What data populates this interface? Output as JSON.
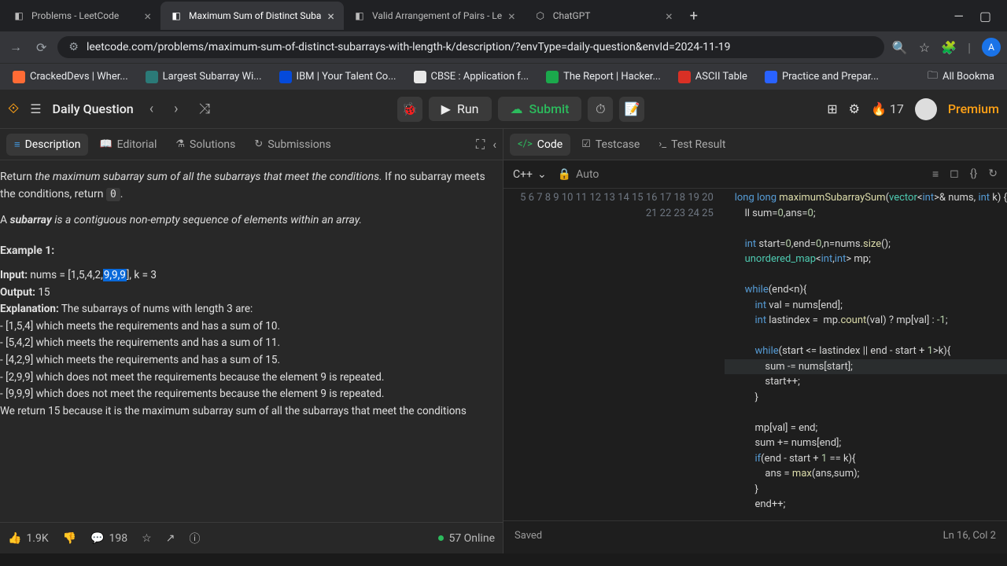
{
  "browser": {
    "tabs": [
      {
        "title": "Problems - LeetCode",
        "active": false
      },
      {
        "title": "Maximum Sum of Distinct Suba",
        "active": true
      },
      {
        "title": "Valid Arrangement of Pairs - Le",
        "active": false
      },
      {
        "title": "ChatGPT",
        "active": false
      }
    ],
    "url": "leetcode.com/problems/maximum-sum-of-distinct-subarrays-with-length-k/description/?envType=daily-question&envId=2024-11-19"
  },
  "bookmarks": [
    {
      "label": "CrackedDevs | Wher...",
      "color": "#ff6b35"
    },
    {
      "label": "Largest Subarray Wi...",
      "color": "#2b7a78"
    },
    {
      "label": "IBM | Your Talent Co...",
      "color": "#054ada"
    },
    {
      "label": "CBSE : Application f...",
      "color": "#e8e8e8"
    },
    {
      "label": "The Report | Hacker...",
      "color": "#1ba94c"
    },
    {
      "label": "ASCII Table",
      "color": "#d93025"
    },
    {
      "label": "Practice and Prepar...",
      "color": "#2962ff"
    }
  ],
  "all_bookmarks": "All Bookma",
  "lc": {
    "daily": "Daily Question",
    "run": "Run",
    "submit": "Submit",
    "streak": "17",
    "premium": "Premium"
  },
  "left_tabs": {
    "description": "Description",
    "editorial": "Editorial",
    "solutions": "Solutions",
    "submissions": "Submissions"
  },
  "problem": {
    "p1_a": "Return ",
    "p1_b": "the maximum subarray sum of all the subarrays that meet the conditions.",
    "p1_c": " If no subarray meets the conditions, return ",
    "p1_code": "0",
    "p1_d": ".",
    "p2_a": "A ",
    "p2_b": "subarray",
    "p2_c": " is a contiguous non-empty sequence of elements within an array.",
    "ex1_head": "Example 1:",
    "ex1_input_lbl": "Input:",
    "ex1_input_a": " nums = [1,5,4,2,",
    "ex1_input_sel": "9,9,9",
    "ex1_input_b": "], k = 3",
    "ex1_output_lbl": "Output:",
    "ex1_output": " 15",
    "ex1_expl_lbl": "Explanation:",
    "ex1_expl": " The subarrays of nums with length 3 are:\n- [1,5,4] which meets the requirements and has a sum of 10.\n- [5,4,2] which meets the requirements and has a sum of 11.\n- [4,2,9] which meets the requirements and has a sum of 15.\n- [2,9,9] which does not meet the requirements because the element 9 is repeated.\n- [9,9,9] which does not meet the requirements because the element 9 is repeated.\nWe return 15 because it is the maximum subarray sum of all the subarrays that meet the conditions"
  },
  "footer": {
    "likes": "1.9K",
    "comments": "198",
    "online": "57 Online",
    "saved": "Saved",
    "cursor": "Ln 16, Col 2"
  },
  "right_tabs": {
    "code": "Code",
    "testcase": "Testcase",
    "result": "Test Result"
  },
  "lang": "C++",
  "auto": "Auto",
  "code": {
    "lines": [
      5,
      6,
      7,
      8,
      9,
      10,
      11,
      12,
      13,
      14,
      15,
      16,
      17,
      18,
      19,
      20,
      21,
      22,
      23,
      24,
      25
    ]
  }
}
